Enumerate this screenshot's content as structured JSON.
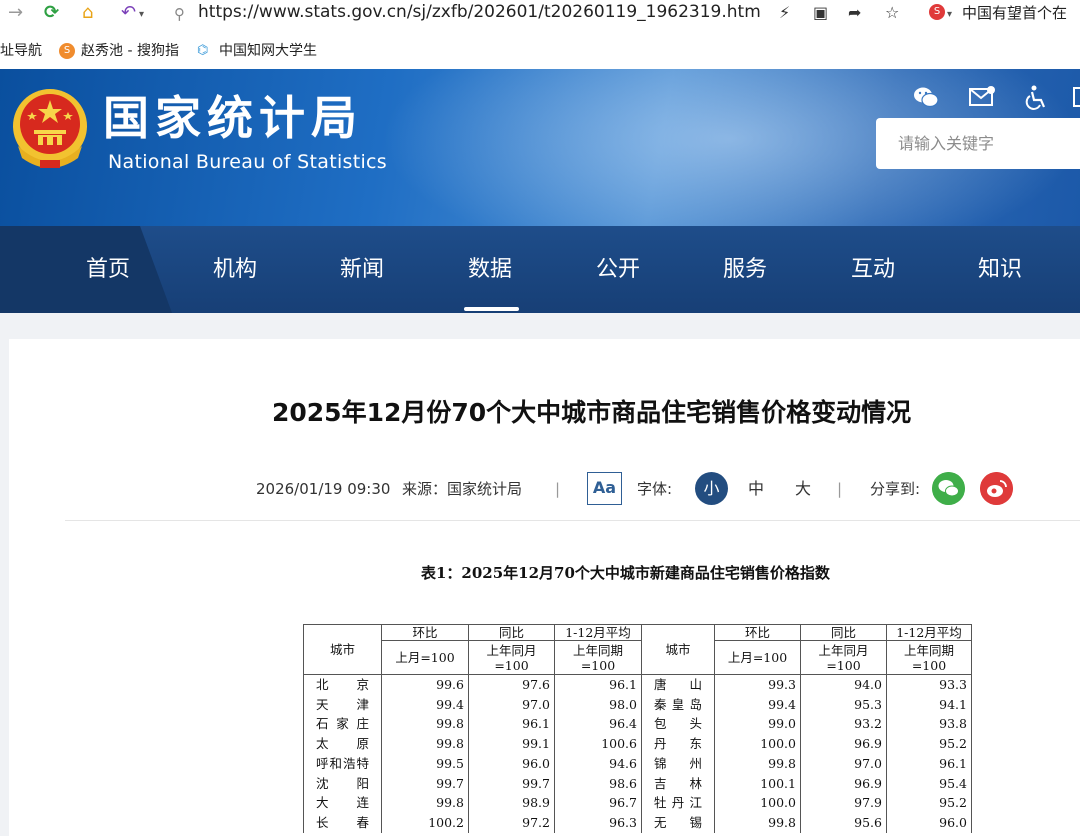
{
  "browser": {
    "url": "https://www.stats.gov.cn/sj/zxfb/202601/t20260119_1962319.htm",
    "search_text": "中国有望首个在"
  },
  "bookmarks": [
    {
      "label": "址导航"
    },
    {
      "label": "赵秀池 - 搜狗指"
    },
    {
      "label": "中国知网大学生"
    }
  ],
  "site": {
    "name_cn": "国家统计局",
    "name_en": "National Bureau of Statistics",
    "search_placeholder": "请输入关键字"
  },
  "nav": [
    {
      "label": "首页"
    },
    {
      "label": "机构"
    },
    {
      "label": "新闻"
    },
    {
      "label": "数据",
      "active": true
    },
    {
      "label": "公开"
    },
    {
      "label": "服务"
    },
    {
      "label": "互动"
    },
    {
      "label": "知识"
    }
  ],
  "article": {
    "title": "2025年12月份70个大中城市商品住宅销售价格变动情况",
    "date": "2026/01/19 09:30",
    "source": "来源：国家统计局",
    "aa": "Aa",
    "font_label": "字体:",
    "size_small": "小",
    "size_medium": "中",
    "size_large": "大",
    "share_label": "分享到:",
    "sep": "|"
  },
  "table": {
    "caption": "表1：2025年12月70个大中城市新建商品住宅销售价格指数",
    "headers": {
      "city": "城市",
      "mom": "环比",
      "yoy": "同比",
      "avg": "1-12月平均",
      "mom_base": "上月=100",
      "yoy_base": "上年同月=100",
      "avg_base": "上年同期=100"
    },
    "rows": [
      {
        "left": {
          "city": "北京",
          "mom": "99.6",
          "yoy": "97.6",
          "avg": "96.1"
        },
        "right": {
          "city": "唐山",
          "mom": "99.3",
          "yoy": "94.0",
          "avg": "93.3"
        }
      },
      {
        "left": {
          "city": "天津",
          "mom": "99.4",
          "yoy": "97.0",
          "avg": "98.0"
        },
        "right": {
          "city": "秦皇岛",
          "mom": "99.4",
          "yoy": "95.3",
          "avg": "94.1"
        }
      },
      {
        "left": {
          "city": "石家庄",
          "mom": "99.8",
          "yoy": "96.1",
          "avg": "96.4"
        },
        "right": {
          "city": "包头",
          "mom": "99.0",
          "yoy": "93.2",
          "avg": "93.8"
        }
      },
      {
        "left": {
          "city": "太原",
          "mom": "99.8",
          "yoy": "99.1",
          "avg": "100.6"
        },
        "right": {
          "city": "丹东",
          "mom": "100.0",
          "yoy": "96.9",
          "avg": "95.2"
        }
      },
      {
        "left": {
          "city": "呼和浩特",
          "mom": "99.5",
          "yoy": "96.0",
          "avg": "94.6"
        },
        "right": {
          "city": "锦州",
          "mom": "99.8",
          "yoy": "97.0",
          "avg": "96.1"
        }
      },
      {
        "left": {
          "city": "沈阳",
          "mom": "99.7",
          "yoy": "99.7",
          "avg": "98.6"
        },
        "right": {
          "city": "吉林",
          "mom": "100.1",
          "yoy": "96.9",
          "avg": "95.4"
        }
      },
      {
        "left": {
          "city": "大连",
          "mom": "99.8",
          "yoy": "98.9",
          "avg": "96.7"
        },
        "right": {
          "city": "牡丹江",
          "mom": "100.0",
          "yoy": "97.9",
          "avg": "95.2"
        }
      },
      {
        "left": {
          "city": "长春",
          "mom": "100.2",
          "yoy": "97.2",
          "avg": "96.3"
        },
        "right": {
          "city": "无锡",
          "mom": "99.8",
          "yoy": "95.6",
          "avg": "96.0"
        }
      }
    ]
  }
}
